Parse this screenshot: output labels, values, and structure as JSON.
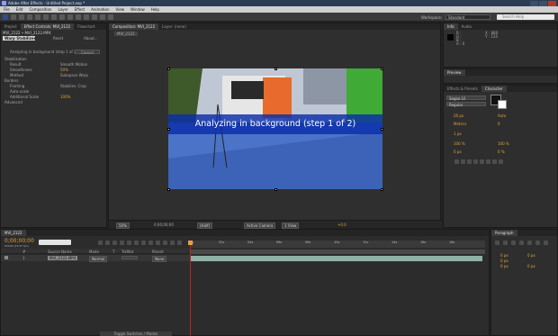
{
  "window": {
    "title": "Adobe After Effects - Untitled Project.aep *",
    "controls": [
      "minimize",
      "maximize",
      "close"
    ]
  },
  "menu": [
    "File",
    "Edit",
    "Composition",
    "Layer",
    "Effect",
    "Animation",
    "View",
    "Window",
    "Help"
  ],
  "toolbar": {
    "tools": [
      "selection",
      "hand",
      "zoom",
      "rotate",
      "camera",
      "pan-behind",
      "rectangle",
      "pen",
      "text",
      "brush",
      "clone-stamp",
      "eraser",
      "roto-brush",
      "puppet"
    ],
    "workspace_label": "Workspace:",
    "workspace_value": "Standard",
    "search_placeholder": "Search Help"
  },
  "effect_controls": {
    "tabs": [
      "Project",
      "Effect Controls: MVI_2122",
      "Flowchart"
    ],
    "header": "MVI_2122 • MVI_2122.MP4",
    "effect_name": "Warp Stabilizer",
    "reset": "Reset",
    "about": "About...",
    "status": "Analyzing in background (step 1 of 2)",
    "cancel_label": "Cancel",
    "rows": [
      {
        "label": "Stabilization",
        "indent": 0
      },
      {
        "label": "Result",
        "value": "Smooth Motion",
        "indent": 1
      },
      {
        "label": "Smoothness",
        "value": "50%",
        "indent": 1
      },
      {
        "label": "Method",
        "value": "Subspace Warp",
        "indent": 1
      },
      {
        "label": "Borders",
        "indent": 0
      },
      {
        "label": "Framing",
        "value": "Stabilize, Crop",
        "indent": 1
      },
      {
        "label": "Auto-scale",
        "indent": 1
      },
      {
        "label": "Additional Scale",
        "value": "100%",
        "indent": 1
      },
      {
        "label": "Advanced",
        "indent": 0
      }
    ]
  },
  "composition": {
    "tabs": [
      "Composition: MVI_2122",
      "Layer: (none)"
    ],
    "crumb": "MVI_2122",
    "overlay_text": "Analyzing in background (step 1 of 2)",
    "footer": {
      "zoom": "50%",
      "timecode": "0;00;00;00",
      "resolution": "(Half)",
      "view": "Active Camera",
      "views": "1 View",
      "exposure": "+0.0"
    }
  },
  "info": {
    "tabs": [
      "Info",
      "Audio"
    ],
    "r": "R :",
    "g": "G :",
    "b": "B :",
    "a": "A : 0",
    "x": "X : 880",
    "y": "Y : 124"
  },
  "preview": {
    "tab": "Preview"
  },
  "character": {
    "tabs": [
      "Effects & Presets",
      "Character"
    ],
    "font": "Segoe UI",
    "style": "Regular",
    "size": "26 px",
    "leading": "Auto",
    "kerning": "Metrics",
    "tracking": "0",
    "stroke": "1 px",
    "vscale": "100 %",
    "hscale": "100 %",
    "baseline": "0 px",
    "tsume": "0 %"
  },
  "timeline": {
    "tab": "MVI_2122",
    "timecode": "0;00;00;00",
    "fps": "00000 (29.97 fps)",
    "search_placeholder": "",
    "columns": [
      "#",
      "Source Name",
      "Mode",
      "T",
      "TrkMat",
      "Parent"
    ],
    "layers": [
      {
        "num": "1",
        "name": "MVI_2122.MP4",
        "mode": "Normal",
        "trkmat": "",
        "parent": "None"
      }
    ],
    "ruler": [
      "0s",
      "02s",
      "04s",
      "06s",
      "08s",
      "10s",
      "12s",
      "14s",
      "16s",
      "18s"
    ],
    "toggle": "Toggle Switches / Modes"
  },
  "paragraph": {
    "tab": "Paragraph",
    "values": [
      "0 px",
      "0 px",
      "0 px",
      "0 px",
      "0 px"
    ]
  }
}
